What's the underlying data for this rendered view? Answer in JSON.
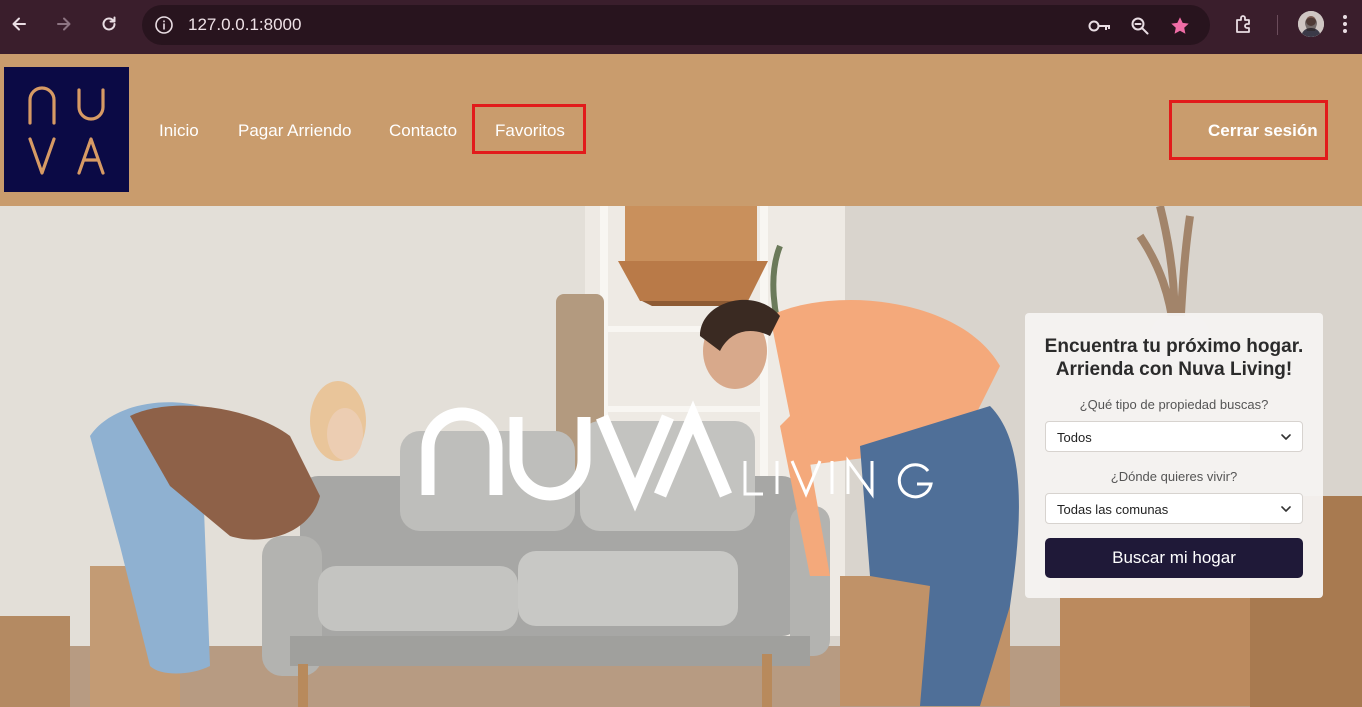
{
  "browser": {
    "url": "127.0.0.1:8000",
    "icons": [
      "back-arrow-icon",
      "forward-arrow-icon",
      "reload-icon",
      "site-info-icon",
      "password-key-icon",
      "zoom-icon",
      "bookmark-star-icon",
      "extensions-icon",
      "profile-avatar",
      "menu-kebab-icon"
    ],
    "star_color": "#f06da6"
  },
  "header": {
    "logo_text_top": "NU",
    "logo_text_bottom": "VA",
    "logo_bg": "#0b0a45",
    "logo_fg": "#d79a64",
    "nav": [
      "Inicio",
      "Pagar Arriendo",
      "Contacto",
      "Favoritos"
    ],
    "logout": "Cerrar sesión",
    "bg": "#c99c6d",
    "highlight_color": "#e21b1b"
  },
  "hero": {
    "brand_main": "NUVA",
    "brand_sub": "LIVING"
  },
  "search": {
    "title_line1": "Encuentra tu próximo hogar.",
    "title_line2": "Arrienda con Nuva Living!",
    "type_label": "¿Qué tipo de propiedad buscas?",
    "type_value": "Todos",
    "where_label": "¿Dónde quieres vivir?",
    "where_value": "Todas las comunas",
    "button": "Buscar mi hogar",
    "button_bg": "#1f1938"
  }
}
